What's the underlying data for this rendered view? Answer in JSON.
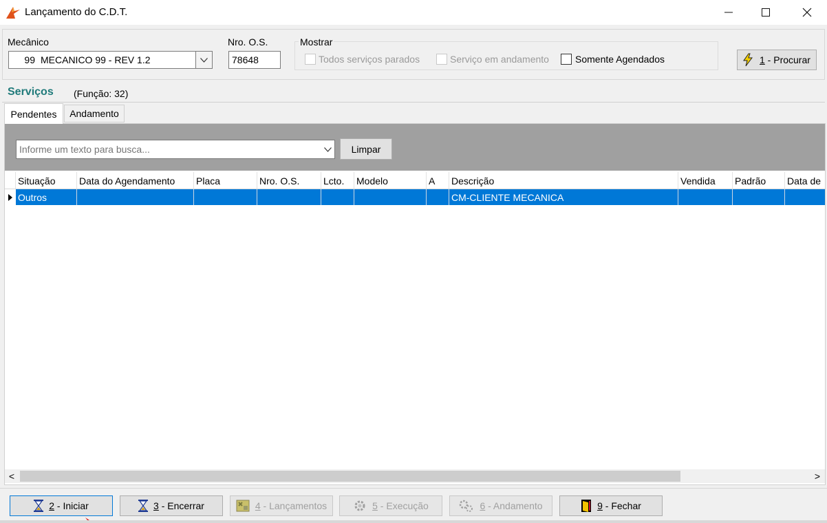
{
  "window": {
    "title": "Lançamento do C.D.T.",
    "minimize": "—",
    "maximize": "☐",
    "close": "✕"
  },
  "filters": {
    "mecanico_label": "Mecânico",
    "mecanico_code": "99",
    "mecanico_name": "MECANICO 99 - REV 1.2",
    "os_label": "Nro. O.S.",
    "os_value": "78648",
    "mostrar_label": "Mostrar",
    "checkboxes": [
      {
        "label": "Todos serviços parados",
        "checked": false,
        "enabled": false
      },
      {
        "label": "Serviço em andamento",
        "checked": false,
        "enabled": false
      },
      {
        "label": "Somente Agendados",
        "checked": false,
        "enabled": true
      }
    ],
    "procurar_key": "1",
    "procurar_label": " - Procurar"
  },
  "servicos": {
    "title": "Serviços",
    "funcao": "(Função: 32)"
  },
  "tabs": [
    {
      "label": "Pendentes",
      "active": true
    },
    {
      "label": "Andamento",
      "active": false
    }
  ],
  "search": {
    "placeholder": "Informe um texto para busca...",
    "clear_label": "Limpar"
  },
  "grid": {
    "columns": [
      "Situação",
      "Data do Agendamento",
      "Placa",
      "Nro. O.S.",
      "Lcto.",
      "Modelo",
      "A",
      "Descrição",
      "Vendida",
      "Padrão",
      "Data de"
    ],
    "rows": [
      [
        "Outros",
        "",
        "",
        "",
        "",
        "",
        "",
        "CM-CLIENTE MECANICA",
        "",
        "",
        ""
      ]
    ]
  },
  "scroll": {
    "left": "<",
    "right": ">"
  },
  "toolbar": [
    {
      "key": "2",
      "label": " - Iniciar",
      "enabled": true,
      "icon": "hourglass-icon"
    },
    {
      "key": "3",
      "label": " - Encerrar",
      "enabled": true,
      "icon": "hourglass-icon"
    },
    {
      "key": "4",
      "label": " - Lançamentos",
      "enabled": false,
      "icon": "launch-icon"
    },
    {
      "key": "5",
      "label": " - Execução",
      "enabled": false,
      "icon": "gear-icon"
    },
    {
      "key": "6",
      "label": " - Andamento",
      "enabled": false,
      "icon": "gears-icon"
    },
    {
      "key": "9",
      "label": " - Fechar",
      "enabled": true,
      "icon": "door-icon"
    }
  ],
  "colors": {
    "accent_title": "#1f7a7a",
    "selection": "#0078d7",
    "search_band": "#a0a0a0"
  }
}
